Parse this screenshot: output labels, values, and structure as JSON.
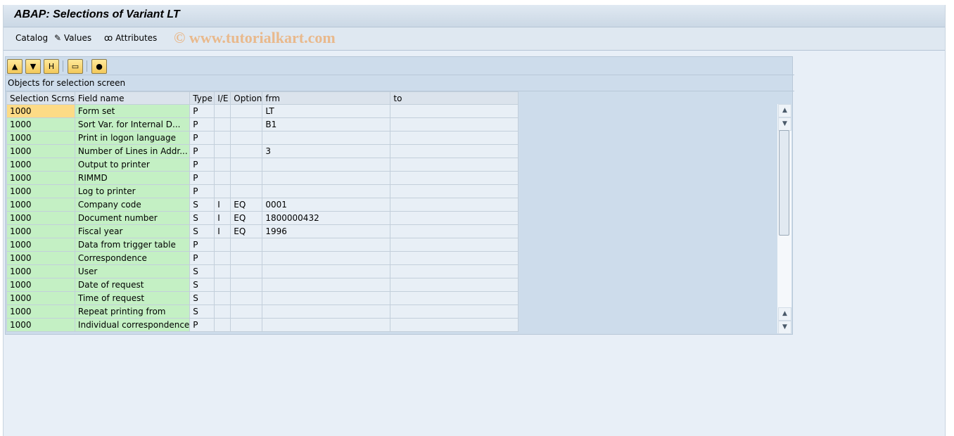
{
  "title": "ABAP: Selections of Variant LT",
  "menu": {
    "catalog": "Catalog",
    "values": "Values",
    "attributes": "Attributes"
  },
  "watermark": "© www.tutorialkart.com",
  "toolbar": [
    "sort-ascending-icon",
    "filter-icon",
    "find-icon",
    "print-icon",
    "layout-color-icon"
  ],
  "panel_title": "Objects for selection screen",
  "columns": [
    "Selection Scrns",
    "Field name",
    "Type",
    "I/E",
    "Option",
    "frm",
    "to"
  ],
  "rows": [
    [
      "1000",
      "Form set",
      "P",
      "",
      "",
      "LT",
      ""
    ],
    [
      "1000",
      "Sort Var. for Internal D...",
      "P",
      "",
      "",
      "B1",
      ""
    ],
    [
      "1000",
      "Print in logon language",
      "P",
      "",
      "",
      "",
      ""
    ],
    [
      "1000",
      "Number of Lines in Addr...",
      "P",
      "",
      "",
      "3",
      ""
    ],
    [
      "1000",
      "Output to printer",
      "P",
      "",
      "",
      "",
      ""
    ],
    [
      "1000",
      "RIMMD",
      "P",
      "",
      "",
      "",
      ""
    ],
    [
      "1000",
      "Log to printer",
      "P",
      "",
      "",
      "",
      ""
    ],
    [
      "1000",
      "Company code",
      "S",
      "I",
      "EQ",
      "0001",
      ""
    ],
    [
      "1000",
      "Document number",
      "S",
      "I",
      "EQ",
      "1800000432",
      ""
    ],
    [
      "1000",
      "Fiscal year",
      "S",
      "I",
      "EQ",
      "1996",
      ""
    ],
    [
      "1000",
      "Data from trigger table",
      "P",
      "",
      "",
      "",
      ""
    ],
    [
      "1000",
      "Correspondence",
      "P",
      "",
      "",
      "",
      ""
    ],
    [
      "1000",
      "User",
      "S",
      "",
      "",
      "",
      ""
    ],
    [
      "1000",
      "Date of request",
      "S",
      "",
      "",
      "",
      ""
    ],
    [
      "1000",
      "Time of request",
      "S",
      "",
      "",
      "",
      ""
    ],
    [
      "1000",
      "Repeat printing from",
      "S",
      "",
      "",
      "",
      ""
    ],
    [
      "1000",
      "Individual correspondence",
      "P",
      "",
      "",
      "",
      ""
    ]
  ]
}
